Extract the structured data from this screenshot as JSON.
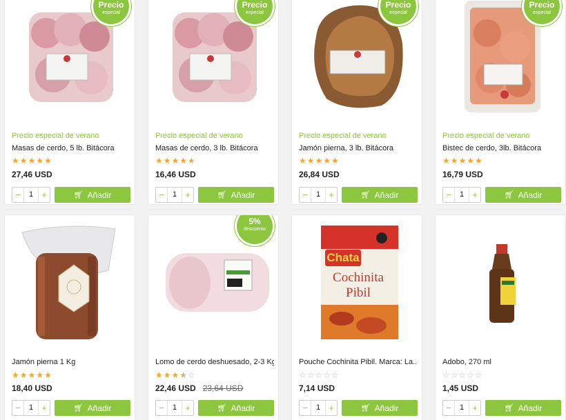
{
  "products": [
    {
      "promo": "Precio especial de verano",
      "name": "Masas de cerdo, 5 lb. Bitácora",
      "rating": 5,
      "price": "27,46 USD",
      "badge_title": "Precio",
      "badge_sub": "especial",
      "qty": "1",
      "add_label": "Añadir",
      "image": "pork-chunks-package"
    },
    {
      "promo": "Precio especial de verano",
      "name": "Masas de cerdo, 3 lb. Bitácora",
      "rating": 4.5,
      "price": "16,46 USD",
      "badge_title": "Precio",
      "badge_sub": "especial",
      "qty": "1",
      "add_label": "Añadir",
      "image": "pork-chunks-package"
    },
    {
      "promo": "Precio especial de verano",
      "name": "Jamón pierna, 3 lb. Bitácora",
      "rating": 5,
      "price": "26,84 USD",
      "badge_title": "Precio",
      "badge_sub": "especial",
      "qty": "1",
      "add_label": "Añadir",
      "image": "ham-package"
    },
    {
      "promo": "Precio especial de verano",
      "name": "Bistec de cerdo, 3lb. Bitácora",
      "rating": 5,
      "price": "16,79 USD",
      "badge_title": "Precio",
      "badge_sub": "especial",
      "qty": "1",
      "add_label": "Añadir",
      "image": "pork-steak-package"
    },
    {
      "promo": "",
      "name": "Jamón pierna 1 Kg",
      "rating": 5,
      "price": "18,40 USD",
      "badge_title": "",
      "badge_sub": "",
      "qty": "1",
      "add_label": "Añadir",
      "image": "ham-leg-package"
    },
    {
      "promo": "",
      "name": "Lomo de cerdo deshuesado, 2-3 Kg,...",
      "rating": 3.5,
      "price": "22,46 USD",
      "old_price": "23,64 USD",
      "badge_title": "5%",
      "badge_sub": "descuento",
      "qty": "1",
      "add_label": "Añadir",
      "image": "pork-loin-package"
    },
    {
      "promo": "",
      "name": "Pouche Cochinita Pibil. Marca: La...",
      "rating": 0,
      "price": "7,14 USD",
      "badge_title": "",
      "badge_sub": "",
      "qty": "1",
      "add_label": "Añadir",
      "image": "cochinita-pibil-pouch",
      "pouch_brand": "Chata",
      "pouch_line1": "Cochinita",
      "pouch_line2": "Pibil"
    },
    {
      "promo": "",
      "name": "Adobo, 270 ml",
      "rating": 0,
      "price": "1,45 USD",
      "badge_title": "",
      "badge_sub": "",
      "qty": "1",
      "add_label": "Añadir",
      "image": "adobo-bottle"
    }
  ],
  "colors": {
    "accent": "#8cc63f",
    "star": "#f5a623"
  },
  "icons": {
    "cart": "cart-icon",
    "minus": "minus-icon",
    "plus": "plus-icon"
  }
}
